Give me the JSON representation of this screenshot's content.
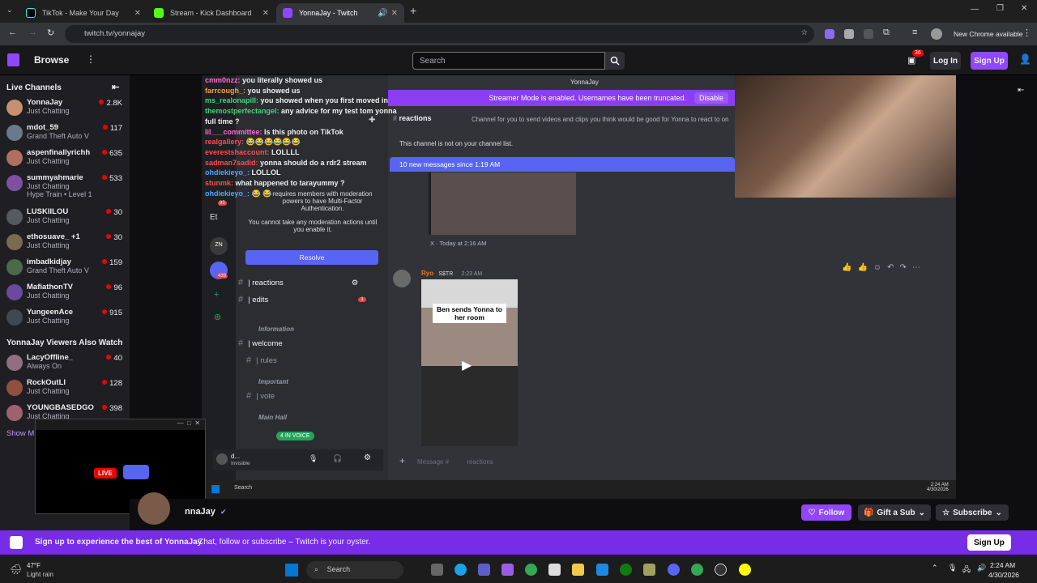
{
  "browser": {
    "tabs": [
      {
        "label": "TikTok - Make Your Day"
      },
      {
        "label": "Stream - Kick Dashboard"
      },
      {
        "label": "YonnaJay - Twitch"
      }
    ],
    "url": "twitch.tv/yonnajay",
    "chrome_available": "New Chrome available"
  },
  "twitch": {
    "browse": "Browse",
    "search_placeholder": "Search",
    "notif_count": "36",
    "login": "Log In",
    "signup": "Sign Up"
  },
  "sidebar": {
    "live_title": "Live Channels",
    "live": [
      {
        "name": "YonnaJay",
        "game": "Just Chatting",
        "viewers": "2.8K",
        "color": "#c89070"
      },
      {
        "name": "mdot_59",
        "game": "Grand Theft Auto V",
        "viewers": "117",
        "color": "#6a7a8a"
      },
      {
        "name": "aspenfinallyrichh",
        "game": "Just Chatting",
        "viewers": "635",
        "color": "#b07060"
      },
      {
        "name": "summyahmarie",
        "game": "Just Chatting",
        "extra": "Hype Train • Level 1",
        "viewers": "533",
        "color": "#8050a0"
      },
      {
        "name": "LUSKIILOU",
        "game": "Just Chatting",
        "viewers": "30",
        "color": "#555a60"
      },
      {
        "name": "ethosuave_ +1",
        "game": "Just Chatting",
        "viewers": "30",
        "color": "#7a6a50"
      },
      {
        "name": "imbadkidjay",
        "game": "Grand Theft Auto V",
        "viewers": "159",
        "color": "#4a6a4a"
      },
      {
        "name": "MafiathonTV",
        "game": "Just Chatting",
        "viewers": "96",
        "color": "#6a4aa0"
      },
      {
        "name": "YungeenAce",
        "game": "Just Chatting",
        "viewers": "915",
        "color": "#404850"
      }
    ],
    "also_title": "YonnaJay Viewers Also Watch",
    "also": [
      {
        "name": "LacyOffline_",
        "game": "Always On",
        "viewers": "40",
        "color": "#907080"
      },
      {
        "name": "RockOutLl",
        "game": "Just Chatting",
        "viewers": "128",
        "color": "#905040"
      },
      {
        "name": "YOUNGBASEDGO",
        "game": "Just Chatting",
        "viewers": "398",
        "color": "#a06070"
      }
    ],
    "show_more": "Show M"
  },
  "stream": {
    "chat_lines": [
      {
        "user": "cmm0nzz:",
        "msg": " you literally showed us",
        "ucolor": "#ff6ad5"
      },
      {
        "user": "farrcough_:",
        "msg": " you showed us",
        "ucolor": "#ff9e3d"
      },
      {
        "user": "ms_realonapill:",
        "msg": " you showed when you first moved in",
        "ucolor": "#3fd57b"
      },
      {
        "user": "themostperfectangel:",
        "msg": " any advice for my test tom yonna",
        "ucolor": "#3fd57b"
      },
      {
        "user": "",
        "msg": "                          full time ?",
        "ucolor": "#fff"
      },
      {
        "user": "lil___committee:",
        "msg": " Is this photo on TikTok",
        "ucolor": "#ff6ad5"
      },
      {
        "user": "realgallery:",
        "msg": " 😂😂😂😂😂😂",
        "ucolor": "#ff4b4b"
      },
      {
        "user": "everestshaccount:",
        "msg": " LOLLLL",
        "ucolor": "#ff4b4b"
      },
      {
        "user": "sadman7sadid:",
        "msg": " yonna should do a rdr2 stream",
        "ucolor": "#ff4b4b"
      },
      {
        "user": "ohdiekieyo_:",
        "msg": " LOLLOL",
        "ucolor": "#5aa0ff"
      },
      {
        "user": "stunmk:",
        "msg": " what happened to tarayummy ?",
        "ucolor": "#ff4b4b"
      },
      {
        "user": "ohdiekieyo_:",
        "msg": " 😂 😂",
        "ucolor": "#5aa0ff"
      }
    ],
    "streamer_mode": "Streamer Mode is enabled. Usernames have been truncated.",
    "disable": "Disable",
    "profile_name": "YonnaJay",
    "mfa_text": "requires members with moderation powers to have Multi-Factor Authentication.",
    "mfa_text2": "You cannot take any moderation actions until you enable it.",
    "resolve": "Resolve",
    "channel_header": "reactions",
    "channel_topic": "Channel for you to send videos and clips you think would be good for Yonna to react to on",
    "not_on_list": "This channel is not on your channel list.",
    "new_messages": "10 new messages since 1:19 AM",
    "x_embed": "X · Today at 2:16 AM",
    "post_user": "Ryo",
    "post_tag": "S$TR",
    "post_time": "2:23 AM",
    "tiktok_caption": "Ben sends Yonna to her room",
    "channels": [
      "| reactions",
      "| edits"
    ],
    "cat_info": "Information",
    "ch_welcome": "| welcome",
    "ch_rules": "| rules",
    "cat_important": "Important",
    "ch_vote": "| vote",
    "cat_main": "Main Hall",
    "voice_count": "4 IN VOICE",
    "edits_badge": "1",
    "server_label": "Et",
    "badge_95": "95",
    "badge_439": "439",
    "user_status": "Invisible",
    "user_short": "d...",
    "message_placeholder": "Message #",
    "msg_channel": "reactions",
    "win_search": "Search",
    "clock_time": "2:24 AM",
    "clock_date": "4/30/2026",
    "mini_live": "LIVE"
  },
  "info": {
    "channel": "nnaJay",
    "follow": "Follow",
    "gift": "Gift a Sub",
    "subscribe": "Subscribe"
  },
  "banner": {
    "t1": "Sign up to experience the best of YonnaJay",
    "t2": "Chat, follow or subscribe – Twitch is your oyster.",
    "button": "Sign Up"
  },
  "taskbar": {
    "weather_temp": "47°F",
    "weather_desc": "Light rain",
    "search": "Search",
    "time": "2:24 AM",
    "date": "4/30/2026"
  }
}
